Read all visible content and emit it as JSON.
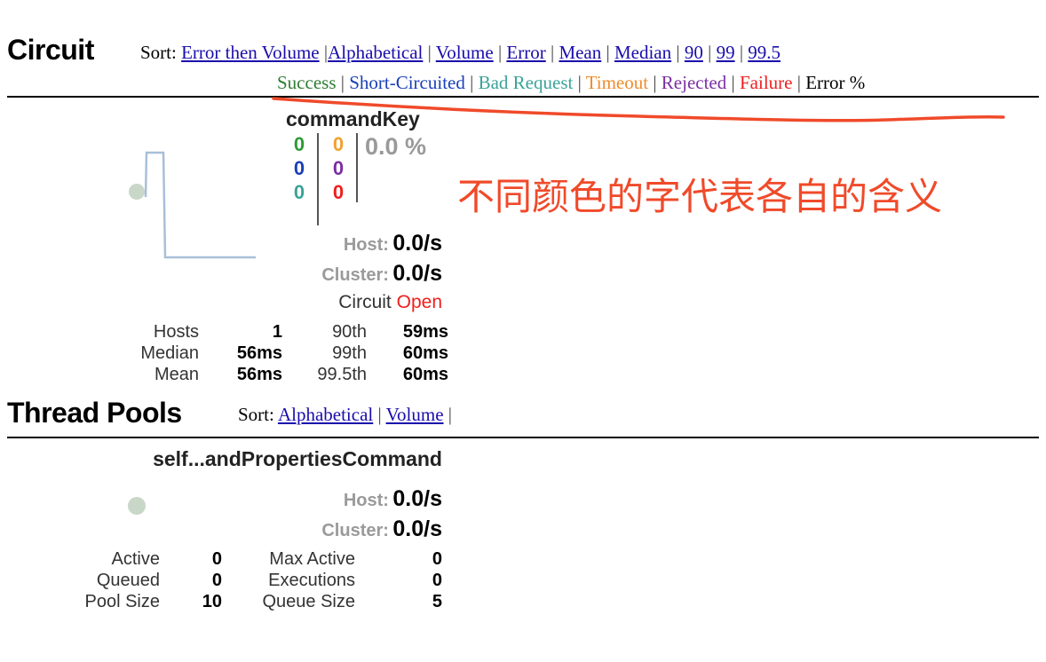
{
  "circuit": {
    "title": "Circuit",
    "sort_label": "Sort:",
    "sort_links": [
      "Error then Volume",
      "Alphabetical",
      "Volume",
      "Error",
      "Mean",
      "Median",
      "90",
      "99",
      "99.5"
    ],
    "legend": [
      {
        "label": "Success",
        "color": "#2e7d32"
      },
      {
        "label": "Short-Circuited",
        "color": "#1a3fb8"
      },
      {
        "label": "Bad Request",
        "color": "#3aa39a"
      },
      {
        "label": "Timeout",
        "color": "#f08c2e"
      },
      {
        "label": "Rejected",
        "color": "#7b2fa3"
      },
      {
        "label": "Failure",
        "color": "#f01e1e"
      },
      {
        "label": "Error %",
        "color": "#000000"
      }
    ],
    "command": {
      "name": "commandKey",
      "counts_left": [
        {
          "value": "0",
          "color": "#2e9a37"
        },
        {
          "value": "0",
          "color": "#1a3fb8"
        },
        {
          "value": "0",
          "color": "#3aa39a"
        }
      ],
      "counts_right": [
        {
          "value": "0",
          "color": "#f0a030"
        },
        {
          "value": "0",
          "color": "#7b2fa3"
        },
        {
          "value": "0",
          "color": "#f01e1e"
        }
      ],
      "error_pct": "0.0 %",
      "host_label": "Host:",
      "host_value": "0.0/s",
      "cluster_label": "Cluster:",
      "cluster_value": "0.0/s",
      "circuit_label": "Circuit",
      "circuit_state": "Open",
      "stats": {
        "hosts_label": "Hosts",
        "hosts_value": "1",
        "median_label": "Median",
        "median_value": "56ms",
        "mean_label": "Mean",
        "mean_value": "56ms",
        "p90_label": "90th",
        "p90_value": "59ms",
        "p99_label": "99th",
        "p99_value": "60ms",
        "p995_label": "99.5th",
        "p995_value": "60ms"
      }
    }
  },
  "annotation": {
    "text": "不同颜色的字代表各自的含义",
    "color": "#f04a2a"
  },
  "thread_pools": {
    "title": "Thread Pools",
    "sort_label": "Sort:",
    "sort_links": [
      "Alphabetical",
      "Volume"
    ],
    "pool": {
      "name": "self...andPropertiesCommand",
      "host_label": "Host:",
      "host_value": "0.0/s",
      "cluster_label": "Cluster:",
      "cluster_value": "0.0/s",
      "stats": {
        "active_label": "Active",
        "active_value": "0",
        "queued_label": "Queued",
        "queued_value": "0",
        "pool_size_label": "Pool Size",
        "pool_size_value": "10",
        "max_active_label": "Max Active",
        "max_active_value": "0",
        "executions_label": "Executions",
        "executions_value": "0",
        "queue_size_label": "Queue Size",
        "queue_size_value": "5"
      }
    }
  }
}
